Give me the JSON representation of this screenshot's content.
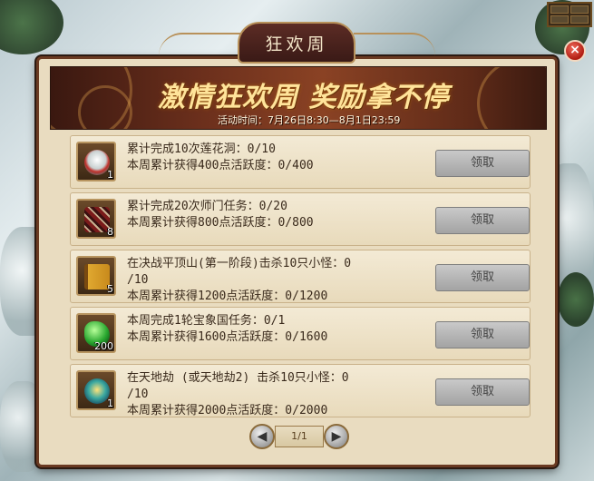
{
  "window": {
    "title": "狂欢周",
    "close_label": "×"
  },
  "banner": {
    "headline": "激情狂欢周 奖励拿不停",
    "subline": "活动时间：7月26日8:30—8月1日23:59"
  },
  "tasks": [
    {
      "icon": "lotus-bowl-icon",
      "quantity": "1",
      "line1": "累计完成10次莲花洞：0/10",
      "line2": "本周累计获得400点活跃度：0/400",
      "button": "领取"
    },
    {
      "icon": "book-bundle-icon",
      "quantity": "8",
      "line1": "累计完成20次师门任务：0/20",
      "line2": "本周累计获得800点活跃度：0/800",
      "button": "领取"
    },
    {
      "icon": "golden-book-icon",
      "quantity": "5",
      "line1": "在决战平顶山(第一阶段)击杀10只小怪：0",
      "line1b": "/10",
      "line2": "本周累计获得1200点活跃度：0/1200",
      "button": "领取"
    },
    {
      "icon": "green-jade-icon",
      "quantity": "200",
      "line1": "本周完成1轮宝象国任务：0/1",
      "line2": "本周累计获得1600点活跃度：0/1600",
      "button": "领取"
    },
    {
      "icon": "spirit-orb-icon",
      "quantity": "1",
      "line1": "在天地劫 (或天地劫2) 击杀10只小怪：0",
      "line1b": "/10",
      "line2": "本周累计获得2000点活跃度：0/2000",
      "button": "领取"
    }
  ],
  "pager": {
    "prev": "◀",
    "page": "1/1",
    "next": "▶"
  },
  "colors": {
    "frame": "#6a3a22",
    "panel": "#e9dcc0",
    "headline": "#ffe49a",
    "button_disabled": "#b5b5b5"
  }
}
